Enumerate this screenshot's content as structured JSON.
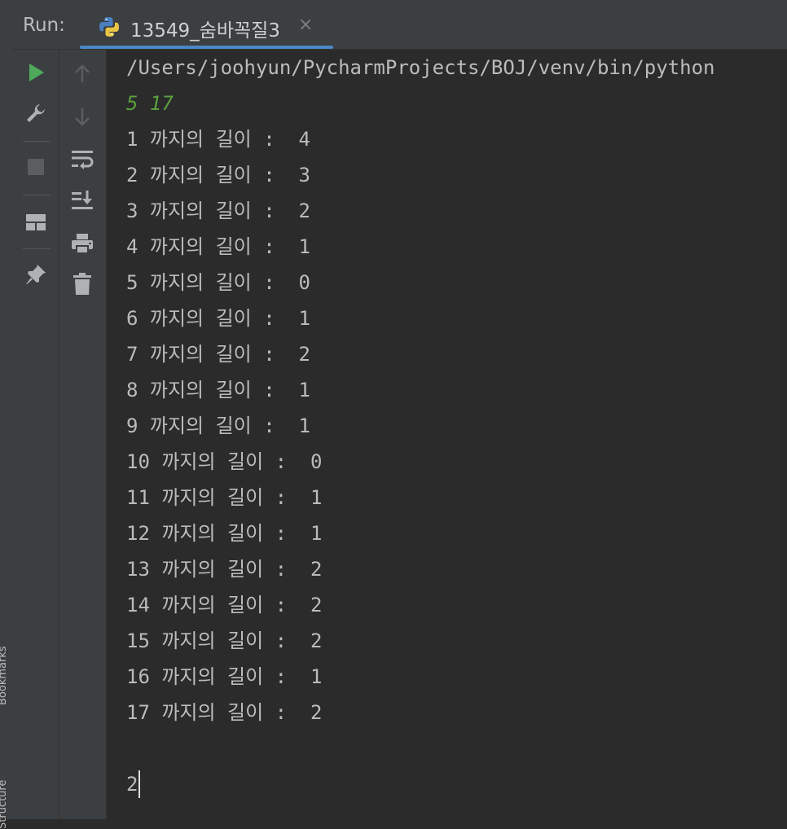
{
  "side_panel": {
    "bookmarks_label": "Bookmarks",
    "structure_label": "Structure"
  },
  "run_panel": {
    "label": "Run:",
    "tab": {
      "title": "13549_숨바꼭질3",
      "icon": "python-icon",
      "close_glyph": "×"
    }
  },
  "toolbar": {
    "left": [
      "run-icon",
      "wrench-icon",
      "stop-icon",
      "layout-icon",
      "pin-icon"
    ],
    "right": [
      "up-arrow-icon",
      "down-arrow-icon",
      "soft-wrap-icon",
      "scroll-to-end-icon",
      "print-icon",
      "trash-icon"
    ]
  },
  "console": {
    "command": "/Users/joohyun/PycharmProjects/BOJ/venv/bin/python",
    "input": "5 17",
    "lines": [
      "1 까지의 길이 :  4",
      "2 까지의 길이 :  3",
      "3 까지의 길이 :  2",
      "4 까지의 길이 :  1",
      "5 까지의 길이 :  0",
      "6 까지의 길이 :  1",
      "7 까지의 길이 :  2",
      "8 까지의 길이 :  1",
      "9 까지의 길이 :  1",
      "10 까지의 길이 :  0",
      "11 까지의 길이 :  1",
      "12 까지의 길이 :  1",
      "13 까지의 길이 :  2",
      "14 까지의 길이 :  2",
      "15 까지의 길이 :  2",
      "16 까지의 길이 :  1",
      "17 까지의 길이 :  2"
    ],
    "result": "2"
  },
  "colors": {
    "background": "#2b2b2b",
    "panel": "#3c3f41",
    "text": "#bbbbbb",
    "input": "#5a9f40",
    "run_green": "#4eaa5a",
    "tab_underline": "#4a88c7"
  }
}
